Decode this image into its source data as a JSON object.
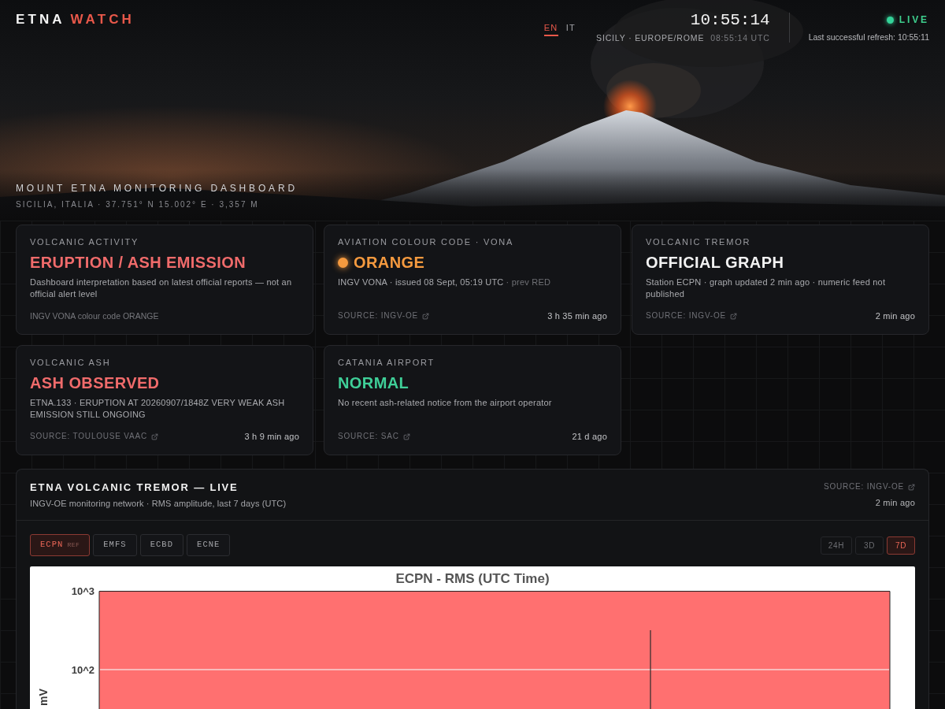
{
  "brand": {
    "name": "ETNA",
    "accent": "WATCH"
  },
  "languages": [
    {
      "label": "EN",
      "selected": true
    },
    {
      "label": "IT",
      "selected": false
    }
  ],
  "clock": {
    "time": "10:55:14",
    "zone": "SICILY · EUROPE/ROME",
    "utc": "08:55:14 UTC"
  },
  "live": {
    "label": "LIVE",
    "on": true,
    "refresh": "Last successful refresh: 10:55:11"
  },
  "hero": {
    "title": "MOUNT ETNA MONITORING DASHBOARD",
    "subtitle": "SICILIA, ITALIA · 37.751° N 15.002° E · 3,357 M"
  },
  "cards": [
    {
      "label": "VOLCANIC ACTIVITY",
      "headline": "ERUPTION / ASH EMISSION",
      "color": "#f06b6b",
      "dot": false,
      "description": "Dashboard interpretation based on latest official reports — not an official alert level",
      "footer": {
        "kind": "note",
        "text": "INGV VONA colour code ORANGE"
      }
    },
    {
      "label": "AVIATION COLOUR CODE · VONA",
      "headline": "ORANGE",
      "color": "#f59a3f",
      "dot": true,
      "description": "INGV VONA · issued 08 Sept, 05:19 UTC",
      "note": "· prev RED",
      "footer": {
        "kind": "source",
        "text": "SOURCE: INGV-OE",
        "age": "3 h 35 min ago"
      }
    },
    {
      "label": "VOLCANIC TREMOR",
      "headline": "OFFICIAL GRAPH",
      "color": "#f2f2f2",
      "dot": false,
      "description": "Station ECPN · graph updated 2 min ago · numeric feed not published",
      "footer": {
        "kind": "source",
        "text": "SOURCE: INGV-OE",
        "age": "2 min ago"
      }
    },
    {
      "label": "VOLCANIC ASH",
      "headline": "ASH OBSERVED",
      "color": "#f06b6b",
      "dot": false,
      "description": "ETNA.133 · ERUPTION AT 20260907/1848Z VERY WEAK ASH EMISSION STILL ONGOING",
      "footer": {
        "kind": "source",
        "text": "SOURCE: TOULOUSE VAAC",
        "age": "3 h 9 min ago"
      }
    },
    {
      "label": "CATANIA AIRPORT",
      "headline": "NORMAL",
      "color": "#3fcf98",
      "dot": false,
      "description": "No recent ash-related notice from the airport operator",
      "footer": {
        "kind": "source",
        "text": "SOURCE: SAC",
        "age": "21 d ago"
      }
    }
  ],
  "tremor_panel": {
    "title": "ETNA VOLCANIC TREMOR — LIVE",
    "subtitle": "INGV-OE monitoring network · RMS amplitude, last 7 days (UTC)",
    "source": "SOURCE: INGV-OE",
    "age": "2 min ago",
    "stations": [
      {
        "label": "ECPN",
        "tag": "REF",
        "selected": true
      },
      {
        "label": "EMFS",
        "selected": false
      },
      {
        "label": "ECBD",
        "selected": false
      },
      {
        "label": "ECNE",
        "selected": false
      }
    ],
    "ranges": [
      {
        "label": "24H",
        "selected": false
      },
      {
        "label": "3D",
        "selected": false
      },
      {
        "label": "7D",
        "selected": true
      }
    ],
    "graph": {
      "title": "ECPN - RMS (UTC Time)",
      "yticks": [
        "10^3",
        "10^2"
      ],
      "ylabel": "mV"
    }
  }
}
